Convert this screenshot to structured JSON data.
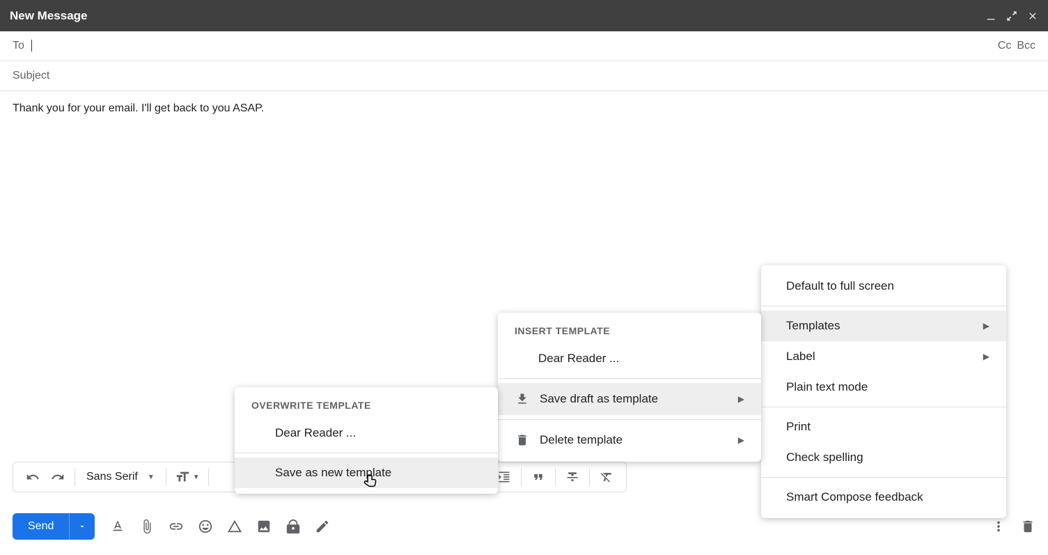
{
  "header": {
    "title": "New Message"
  },
  "fields": {
    "to_label": "To",
    "to_value": "",
    "cc": "Cc",
    "bcc": "Bcc",
    "subject_placeholder": "Subject"
  },
  "body": {
    "content": "Thank you for your email. I'll get back to you ASAP."
  },
  "toolbar": {
    "font": "Sans Serif",
    "send_label": "Send"
  },
  "main_menu": {
    "full_screen": "Default to full screen",
    "templates": "Templates",
    "label": "Label",
    "plain_text": "Plain text mode",
    "print": "Print",
    "check_spelling": "Check spelling",
    "smart_compose": "Smart Compose feedback"
  },
  "templates_menu": {
    "insert_header": "INSERT TEMPLATE",
    "template1": "Dear Reader ...",
    "save_draft": "Save draft as template",
    "delete_template": "Delete template"
  },
  "overwrite_menu": {
    "header": "OVERWRITE TEMPLATE",
    "template1": "Dear Reader ...",
    "save_new": "Save as new template"
  }
}
